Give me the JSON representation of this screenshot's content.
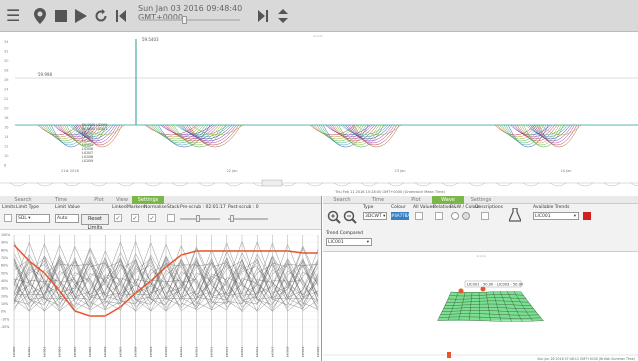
{
  "toolbar": {
    "datetime": "Sun Jan 03 2016 09:48:40 GMT+0000"
  },
  "main_chart": {
    "y_labels": [
      "34",
      "32",
      "30",
      "28",
      "26",
      "24",
      "22",
      "20",
      "18",
      "16",
      "14",
      "12",
      "10",
      "8"
    ],
    "x_labels": [
      "21st\n2016",
      "22 Jan",
      "23 Jan",
      "24 Jan"
    ],
    "peak_label": "59.5403",
    "ref_label": "59.998",
    "hover_labels": [
      "50.0000 LIC000",
      "50.0000 LIC001",
      "LIC002",
      "LIC003",
      "LIC004",
      "LIC005",
      "LIC006",
      "LIC007",
      "LIC008",
      "LIC009"
    ]
  },
  "timeline": {
    "caption": "Thu Feb 11 2016 15:28:00 GMT+0000 (Greenwich Mean Time)",
    "right_caption": "Sun Jun 26 2016 07:46:12 GMT+0100 (British Summer Time)"
  },
  "left_panel": {
    "tabs": [
      "Search",
      "Time",
      "Plot",
      "View",
      "Settings"
    ],
    "active_tab": "Settings",
    "labels": {
      "limits": "Limits",
      "limit_type": "Limit Type",
      "limit_value": "Limit Value",
      "linked": "Linked",
      "markers": "Markers",
      "normalise": "Normalise",
      "stack": "Stack",
      "pre_scrub": "Pre-scrub : 02:01:17",
      "post_scrub": "Post-scrub : 0"
    },
    "limit_type_value": "SDL",
    "limit_value_value": "Auto",
    "reset_limits": "Reset Limits",
    "y_ticks": [
      "100%",
      "90%",
      "80%",
      "70%",
      "60%",
      "50%",
      "40%",
      "30%",
      "20%",
      "10%",
      "0%",
      "-10%",
      "-20%"
    ],
    "columns": [
      "LIC000",
      "LIC001",
      "LIC002",
      "LIC003",
      "LIC004",
      "LIC005",
      "LIC006",
      "LIC007",
      "LIC008",
      "LIC009",
      "LIC010",
      "LIC011",
      "LIC012",
      "LIC013",
      "LIC014",
      "LIC015",
      "LIC016",
      "LIC017",
      "LIC018",
      "LIC019",
      "LIC020"
    ]
  },
  "right_panel": {
    "tabs": [
      "Search",
      "Time",
      "Plot",
      "Wave",
      "Settings"
    ],
    "active_tab": "Wave",
    "labels": {
      "type": "Type",
      "colour": "Colour",
      "all_values": "All Values",
      "relative": "Relative",
      "bbw_colour": "B&W / Colour",
      "descriptions": "Descriptions",
      "available_trends": "Available Trends",
      "trend_compared": "Trend Compared"
    },
    "type_value": "3DCWT",
    "colour_value": "#4A77BA",
    "available_value": "LIC001",
    "compared_value": "LIC001",
    "surface_label": "LIC001 - 50.00 - LIC003 - 50.00"
  },
  "colors": {
    "accent": "#7ab648",
    "red_curve": "#e8542a",
    "toolbar": "#d9d9d9",
    "teal_line": "#2a9d8f"
  }
}
